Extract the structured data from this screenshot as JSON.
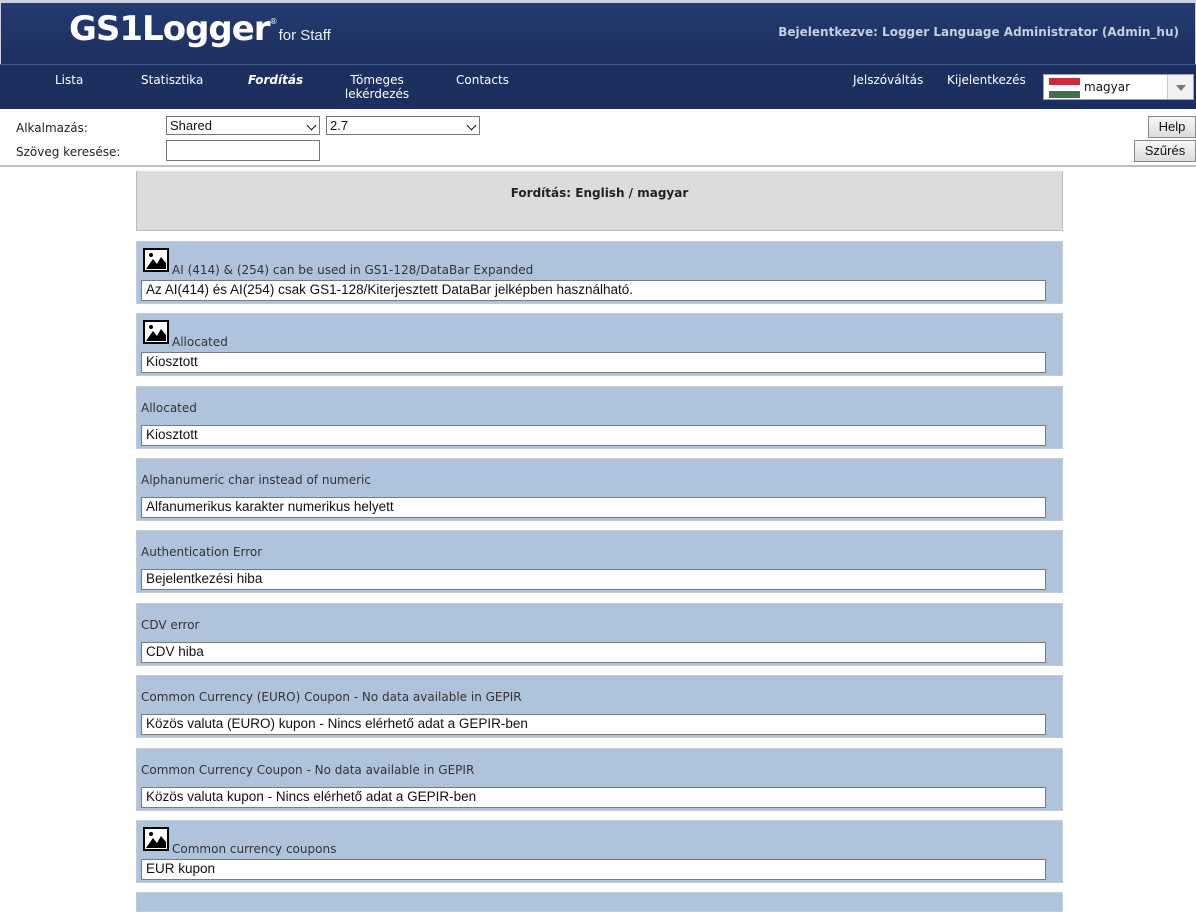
{
  "header": {
    "logo_main": "GS1Logger",
    "logo_reg": "®",
    "logo_sub": "for Staff",
    "login_info": "Bejelentkezve: Logger Language Administrator (Admin_hu)"
  },
  "nav": {
    "items": [
      "Lista",
      "Statisztika",
      "Fordítás",
      "Tömeges lekérdezés",
      "Contacts"
    ],
    "active": "Fordítás",
    "right_items": [
      "Jelszóváltás",
      "Kijelentkezés"
    ],
    "language": "magyar",
    "flag_colors": [
      "#cd2a3e",
      "#ffffff",
      "#436f4d"
    ]
  },
  "toolbar": {
    "app_label": "Alkalmazás:",
    "app_value": "Shared",
    "version_value": "2.7",
    "search_label": "Szöveg keresése:",
    "search_value": "",
    "help_button": "Help",
    "filter_button": "Szűrés"
  },
  "main": {
    "title": "Fordítás: English / magyar",
    "entries": [
      {
        "source": "AI (414) & (254) can be used in GS1-128/DataBar Expanded",
        "translation": "Az AI(414) és AI(254) csak GS1-128/Kiterjesztett DataBar jelképben használható.",
        "has_image": true
      },
      {
        "source": "Allocated",
        "translation": "Kiosztott",
        "has_image": true
      },
      {
        "source": "Allocated",
        "translation": "Kiosztott",
        "has_image": false
      },
      {
        "source": "Alphanumeric char instead of numeric",
        "translation": "Alfanumerikus karakter numerikus helyett",
        "has_image": false
      },
      {
        "source": "Authentication Error",
        "translation": "Bejelentkezési hiba",
        "has_image": false
      },
      {
        "source": "CDV error",
        "translation": "CDV hiba",
        "has_image": false
      },
      {
        "source": "Common Currency (EURO) Coupon - No data available in GEPIR",
        "translation": "Közös valuta (EURO) kupon - Nincs elérhető adat a GEPIR-ben",
        "has_image": false
      },
      {
        "source": "Common Currency Coupon - No data available in GEPIR",
        "translation": "Közös valuta kupon - Nincs elérhető adat a GEPIR-ben",
        "has_image": false
      },
      {
        "source": "Common currency coupons",
        "translation": "EUR kupon",
        "has_image": true
      }
    ]
  }
}
